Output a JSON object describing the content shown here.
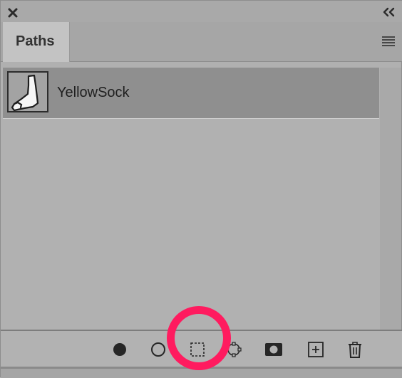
{
  "panel": {
    "tab_label": "Paths",
    "paths": [
      {
        "name": "YellowSock"
      }
    ]
  },
  "icons": {
    "close": "close-icon",
    "collapse": "double-chevron-left-icon",
    "menu": "hamburger-menu-icon",
    "fill_path": "filled-circle-icon",
    "stroke_path": "hollow-circle-icon",
    "load_selection": "dashed-square-selection-icon",
    "make_work_path": "path-anchor-icon",
    "add_mask": "mask-icon",
    "new_path": "plus-square-icon",
    "delete_path": "trash-icon"
  },
  "colors": {
    "highlight_ring": "#ff1b5f"
  }
}
